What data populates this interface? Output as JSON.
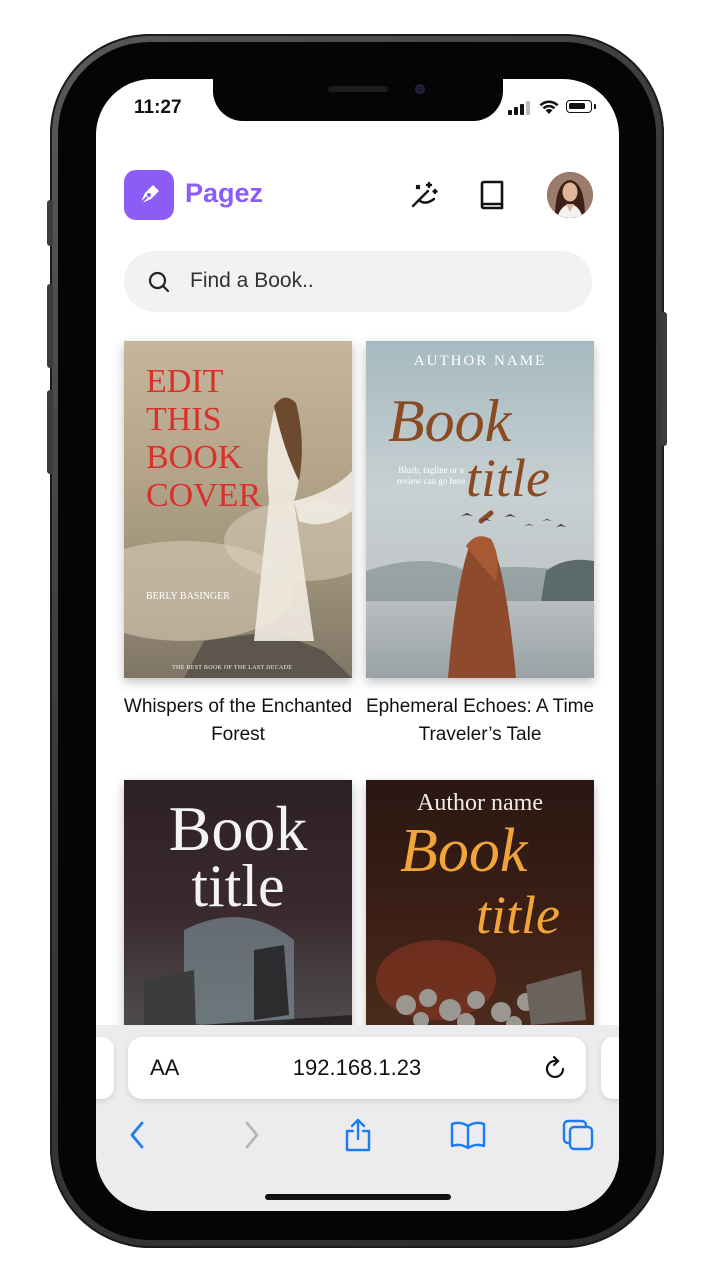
{
  "status_bar": {
    "time": "11:27",
    "battery_level": 0.85
  },
  "header": {
    "app_name": "Pagez",
    "icons": [
      "pen-nib-icon",
      "magic-wand-icon",
      "book-icon"
    ],
    "avatar": "user-avatar"
  },
  "search": {
    "placeholder": "Find a Book.."
  },
  "books": [
    {
      "title": "Whispers of the Enchanted Forest",
      "cover": {
        "lines": [
          "EDIT",
          "THIS",
          "BOOK",
          "COVER"
        ],
        "author": "BERLY BASINGER",
        "tagline": "THE BEST BOOK OF THE LAST DECADE"
      }
    },
    {
      "title": "Ephemeral Echoes: A Time Traveler’s Tale",
      "cover": {
        "author": "AUTHOR NAME",
        "title_line1": "Book",
        "title_line2": "title",
        "blurb": "Blurb, tagline or a review can go here"
      }
    },
    {
      "title": "",
      "cover": {
        "title_line1": "Book",
        "title_line2": "title"
      }
    },
    {
      "title": "",
      "cover": {
        "author": "Author name",
        "title_line1": "Book",
        "title_line2": "title"
      }
    }
  ],
  "browser": {
    "text_size_label": "AA",
    "url": "192.168.1.23",
    "toolbar": [
      "back-icon",
      "forward-icon",
      "share-icon",
      "bookmarks-icon",
      "tabs-icon"
    ]
  },
  "colors": {
    "accent": "#8c5cf6",
    "safari_blue": "#1c7cf4",
    "cover1_title": "#d9302a",
    "cover2_title": "#8a4a22",
    "cover4_title": "#f0a43a"
  }
}
